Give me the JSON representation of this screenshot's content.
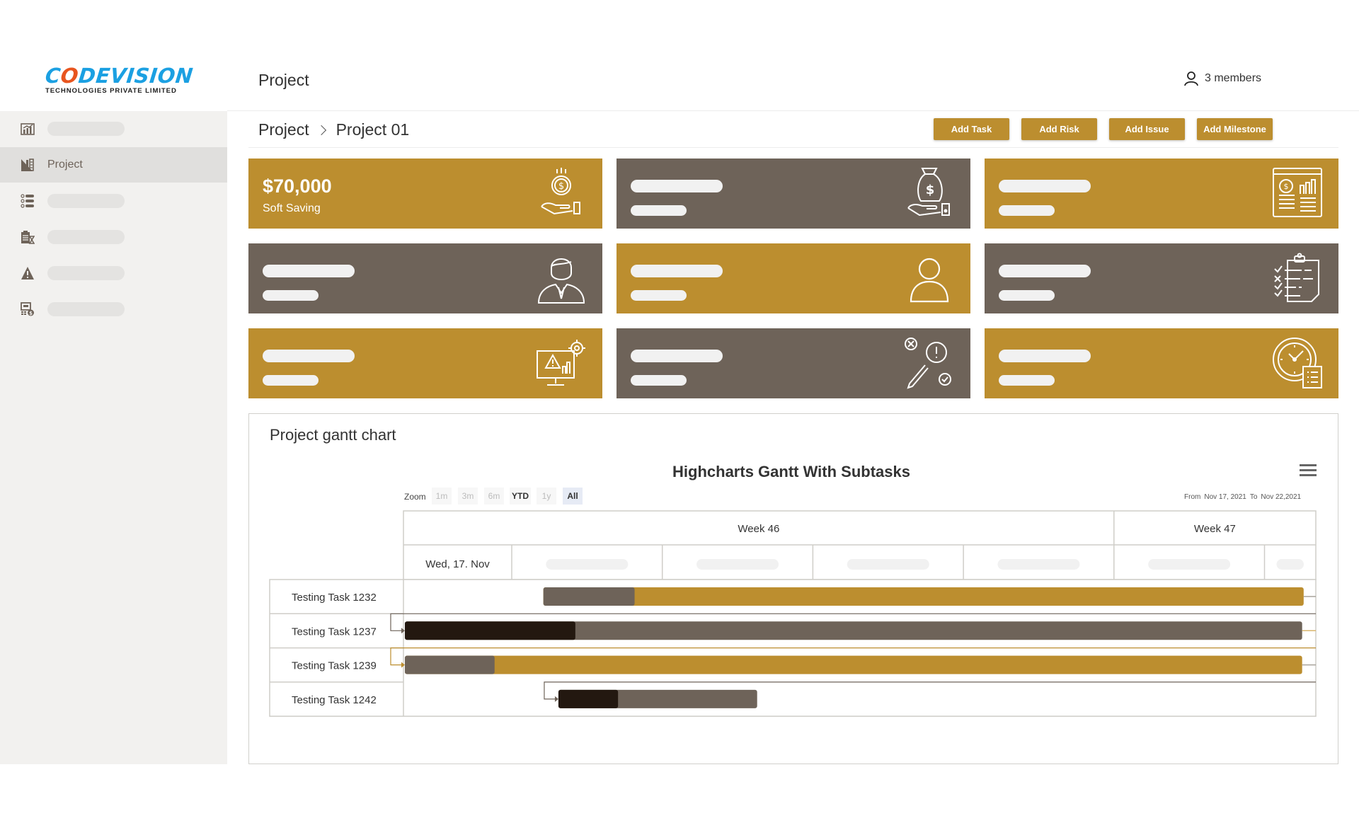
{
  "header": {
    "logo_main_pre": "C",
    "logo_main_o": "O",
    "logo_main_post": "DEVISION",
    "logo_sub": "TECHNOLOGIES PRIVATE LIMITED",
    "page_title": "Project",
    "members_label": "3 members",
    "members_icon": "user-icon"
  },
  "sidebar": {
    "items": [
      {
        "icon": "chart-icon",
        "label": null,
        "active": false
      },
      {
        "icon": "project-icon",
        "label": "Project",
        "active": true
      },
      {
        "icon": "list-icon",
        "label": null,
        "active": false
      },
      {
        "icon": "clipboard-icon",
        "label": null,
        "active": false
      },
      {
        "icon": "warning-icon",
        "label": null,
        "active": false
      },
      {
        "icon": "budget-icon",
        "label": null,
        "active": false
      }
    ]
  },
  "breadcrumb": {
    "root": "Project",
    "current": "Project 01"
  },
  "toolbar": {
    "add_task": "Add Task",
    "add_risk": "Add Risk",
    "add_issue": "Add Issue",
    "add_milestone": "Add Milestone"
  },
  "colors": {
    "gold": "#bc8e2f",
    "brown": "#6e6359",
    "dark": "#231810",
    "sidebar_bg": "#f2f1ef",
    "sidebar_active": "#e0dfdd",
    "logo_blue": "#1ba0e2",
    "logo_orange": "#e8551f"
  },
  "cards": [
    {
      "value": "$70,000",
      "label": "Soft Saving",
      "color": "gold",
      "icon": "money-hand-icon"
    },
    {
      "value": null,
      "label": null,
      "color": "brown",
      "icon": "money-bag-hand-icon"
    },
    {
      "value": null,
      "label": null,
      "color": "gold",
      "icon": "financial-report-icon"
    },
    {
      "value": null,
      "label": null,
      "color": "brown",
      "icon": "manager-icon"
    },
    {
      "value": null,
      "label": null,
      "color": "gold",
      "icon": "person-icon"
    },
    {
      "value": null,
      "label": null,
      "color": "brown",
      "icon": "checklist-icon"
    },
    {
      "value": null,
      "label": null,
      "color": "gold",
      "icon": "risk-monitor-icon"
    },
    {
      "value": null,
      "label": null,
      "color": "brown",
      "icon": "issue-tools-icon"
    },
    {
      "value": null,
      "label": null,
      "color": "gold",
      "icon": "schedule-clock-icon"
    }
  ],
  "gantt": {
    "section_title": "Project gantt chart",
    "chart_title": "Highcharts Gantt With Subtasks",
    "zoom_label": "Zoom",
    "zoom_buttons": [
      {
        "label": "1m",
        "state": "disabled"
      },
      {
        "label": "3m",
        "state": "disabled"
      },
      {
        "label": "6m",
        "state": "disabled"
      },
      {
        "label": "YTD",
        "state": "enabled"
      },
      {
        "label": "1y",
        "state": "disabled"
      },
      {
        "label": "All",
        "state": "selected"
      }
    ],
    "range_from_label": "From",
    "range_from": "Nov 17, 2021",
    "range_to_label": "To",
    "range_to": "Nov 22,2021",
    "week_labels": [
      "Week 46",
      "Week 47"
    ],
    "day_labels": [
      "Wed, 17. Nov",
      null,
      null,
      null,
      null,
      null,
      null
    ]
  },
  "chart_data": {
    "type": "gantt",
    "title": "Highcharts Gantt With Subtasks",
    "x_unit": "day of November 2021",
    "x_range": [
      17.28,
      23.33
    ],
    "weeks": [
      {
        "label": "Week 46",
        "start": 15,
        "end": 22
      },
      {
        "label": "Week 47",
        "start": 22,
        "end": 29
      }
    ],
    "day_ticks": [
      17,
      18,
      19,
      20,
      21,
      22,
      23
    ],
    "day_labels": [
      "Wed, 17. Nov",
      "",
      "",
      "",
      "",
      "",
      ""
    ],
    "tasks": [
      {
        "name": "Testing Task 1232",
        "start": 18.21,
        "end": 23.26,
        "completed": 0.12,
        "color": "gold",
        "progress_color": "brown",
        "depends_on": null
      },
      {
        "name": "Testing Task 1237",
        "start": 17.29,
        "end": 23.25,
        "completed": 0.19,
        "color": "brown",
        "progress_color": "dark",
        "depends_on": "Testing Task 1232"
      },
      {
        "name": "Testing Task 1239",
        "start": 17.29,
        "end": 23.25,
        "completed": 0.1,
        "color": "gold",
        "progress_color": "brown",
        "depends_on": "Testing Task 1237"
      },
      {
        "name": "Testing Task 1242",
        "start": 18.31,
        "end": 19.63,
        "completed": 0.3,
        "color": "brown",
        "progress_color": "dark",
        "depends_on": "Testing Task 1239"
      }
    ]
  }
}
